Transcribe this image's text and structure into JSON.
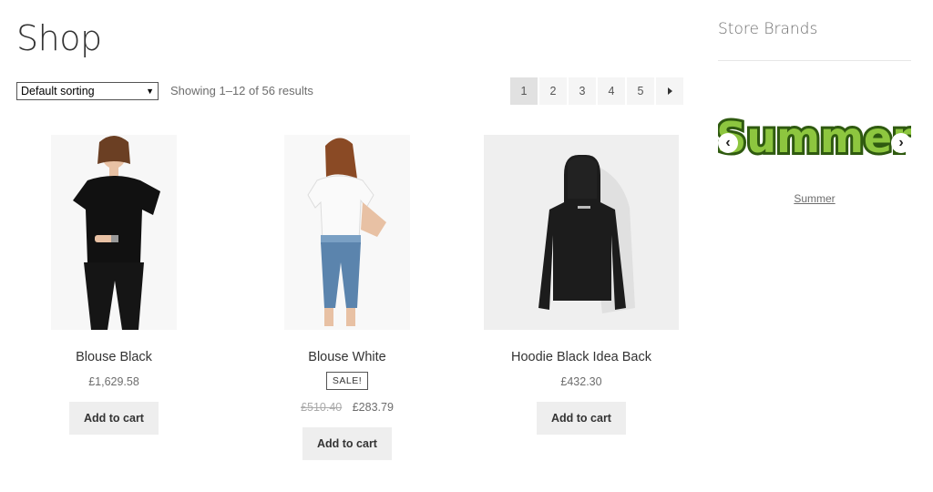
{
  "page": {
    "title": "Shop"
  },
  "toolbar": {
    "sort_value": "Default sorting",
    "result_count": "Showing 1–12 of 56 results"
  },
  "pagination": {
    "pages": [
      "1",
      "2",
      "3",
      "4",
      "5"
    ],
    "current": "1",
    "next_icon": "chevron-right-icon"
  },
  "products": [
    {
      "title": "Blouse Black",
      "price": "£1,629.58",
      "button": "Add to cart"
    },
    {
      "title": "Blouse White",
      "badge": "SALE!",
      "old_price": "£510.40",
      "price": "£283.79",
      "button": "Add to cart"
    },
    {
      "title": "Hoodie Black Idea Back",
      "price": "£432.30",
      "button": "Add to cart"
    }
  ],
  "sidebar": {
    "title": "Store Brands",
    "brand_logo_text": "Summer",
    "brand_link": "Summer",
    "prev_icon": "chevron-left-icon",
    "next_icon": "chevron-right-icon"
  },
  "colors": {
    "brand_logo_green": "#8dc63f",
    "button_bg": "#eeeeee"
  }
}
